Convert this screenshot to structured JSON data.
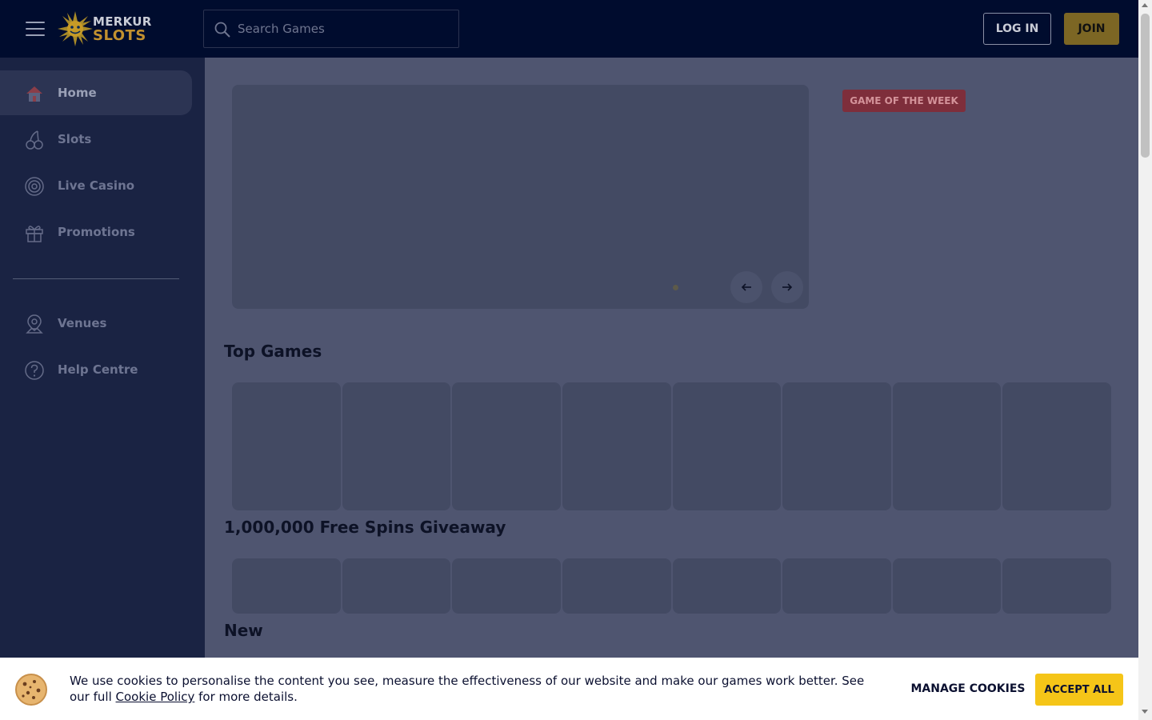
{
  "header": {
    "logo": {
      "line1": "MERKUR",
      "line2": "SLOTS"
    },
    "search": {
      "placeholder": "Search Games",
      "icon": "search-icon"
    },
    "login_label": "LOG IN",
    "join_label": "JOIN"
  },
  "sidebar": {
    "items": [
      {
        "label": "Home",
        "icon": "home-icon",
        "active": true
      },
      {
        "label": "Slots",
        "icon": "cherries-icon"
      },
      {
        "label": "Live Casino",
        "icon": "roulette-icon"
      },
      {
        "label": "Promotions",
        "icon": "gift-icon"
      },
      {
        "label": "Venues",
        "icon": "map-pin-icon"
      },
      {
        "label": "Help Centre",
        "icon": "question-circle-icon"
      }
    ]
  },
  "main": {
    "game_of_week_label": "GAME OF THE WEEK",
    "sections": [
      {
        "title": "Top Games"
      },
      {
        "title": "1,000,000 Free Spins Giveaway"
      },
      {
        "title": "New"
      }
    ]
  },
  "cookie_banner": {
    "text": "We use cookies to personalise the content you see, measure the effectiveness of our website and make our games work better. See our full",
    "link_text": "Cookie Policy",
    "text_suffix": " for more details.",
    "manage_label": "MANAGE COOKIES",
    "accept_label": "ACCEPT ALL"
  },
  "colors": {
    "header_bg": "#000c2e",
    "sidebar_bg": "#1a2343",
    "main_bg": "#4f5570",
    "join_bg": "#7c6624",
    "accept_bg": "#f5c518",
    "gotw_bg": "#7e2e3b"
  }
}
